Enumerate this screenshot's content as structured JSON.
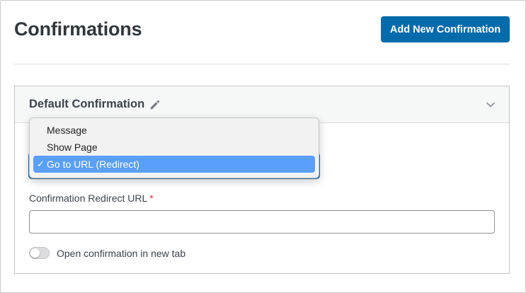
{
  "header": {
    "title": "Confirmations",
    "add_button_label": "Add New Confirmation"
  },
  "panel": {
    "title": "Default Confirmation",
    "icons": {
      "edit": "pencil-icon",
      "collapse": "chevron-down-icon"
    }
  },
  "confirmation_type": {
    "options": [
      "Message",
      "Show Page",
      "Go to URL (Redirect)"
    ],
    "selected": "Go to URL (Redirect)",
    "check_mark": "✓"
  },
  "redirect_url": {
    "label": "Confirmation Redirect URL",
    "required_mark": "*",
    "value": ""
  },
  "new_tab_toggle": {
    "label": "Open confirmation in new tab",
    "checked": false
  },
  "colors": {
    "primary": "#036aab",
    "required": "#d63638",
    "menu_highlight": "#5a9ffa"
  }
}
